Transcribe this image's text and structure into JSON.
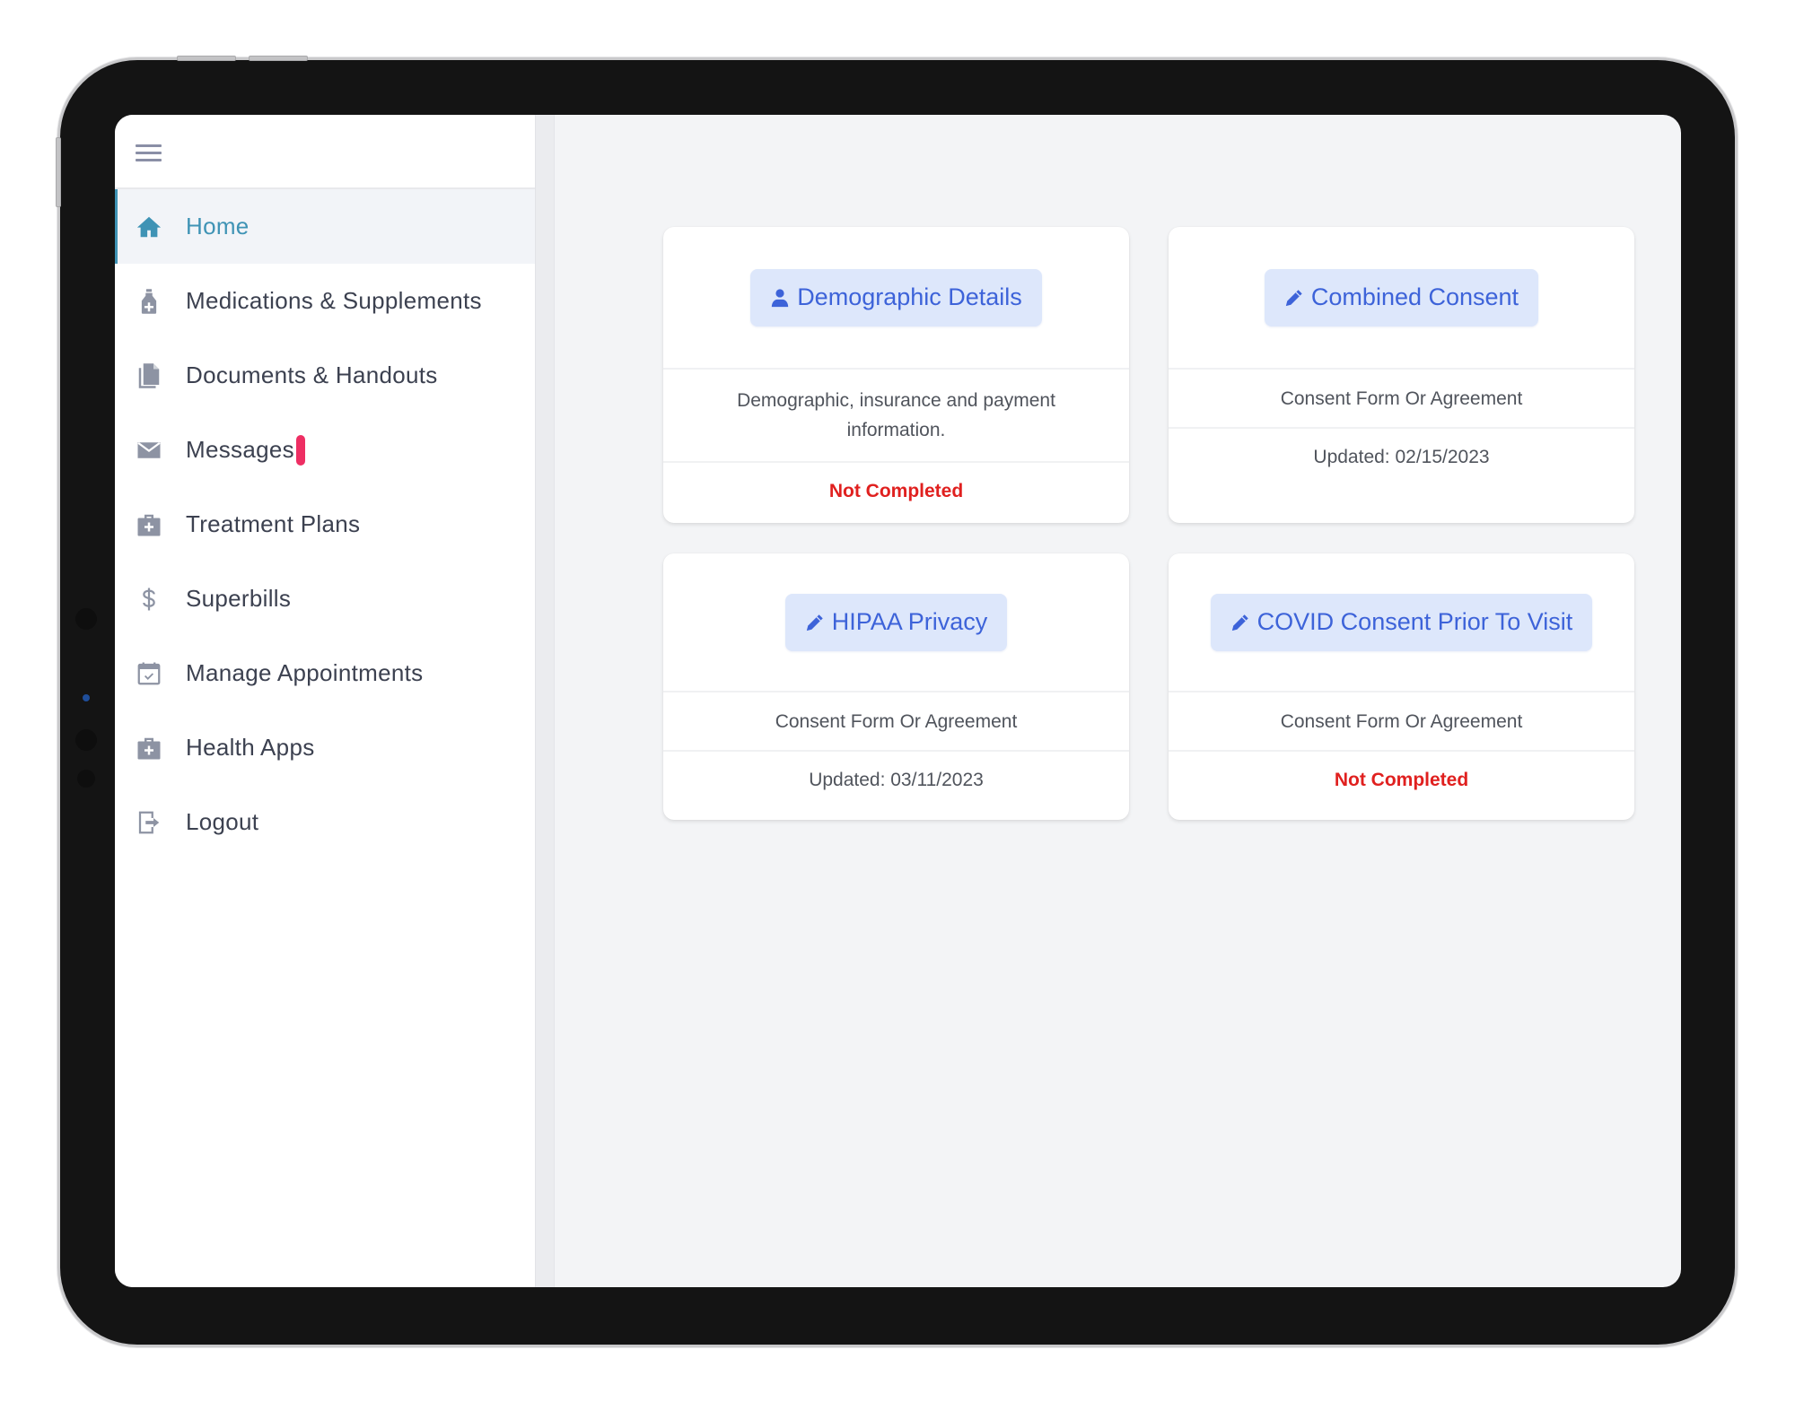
{
  "device": {
    "frame": "tablet"
  },
  "sidebar": {
    "menu_icon": "hamburger-icon",
    "items": [
      {
        "label": "Home",
        "icon": "home-icon",
        "active": true
      },
      {
        "label": "Medications & Supplements",
        "icon": "medicine-bottle-icon",
        "active": false
      },
      {
        "label": "Documents & Handouts",
        "icon": "documents-icon",
        "active": false
      },
      {
        "label": "Messages",
        "icon": "envelope-icon",
        "active": false,
        "badge": true
      },
      {
        "label": "Treatment Plans",
        "icon": "medical-kit-icon",
        "active": false
      },
      {
        "label": "Superbills",
        "icon": "dollar-icon",
        "active": false
      },
      {
        "label": "Manage Appointments",
        "icon": "calendar-check-icon",
        "active": false
      },
      {
        "label": "Health Apps",
        "icon": "medical-kit-icon",
        "active": false
      },
      {
        "label": "Logout",
        "icon": "logout-icon",
        "active": false
      }
    ]
  },
  "cards": [
    {
      "button_label": "Demographic Details",
      "icon": "user-icon",
      "description": "Demographic, insurance and payment information.",
      "status": "Not Completed",
      "status_type": "incomplete"
    },
    {
      "button_label": "Combined Consent",
      "icon": "pencil-icon",
      "description": "Consent Form Or Agreement",
      "status": "Updated: 02/15/2023",
      "status_type": "updated"
    },
    {
      "button_label": "HIPAA Privacy",
      "icon": "pencil-icon",
      "description": "Consent Form Or Agreement",
      "status": "Updated: 03/11/2023",
      "status_type": "updated"
    },
    {
      "button_label": "COVID Consent Prior To Visit",
      "icon": "pencil-icon",
      "description": "Consent Form Or Agreement",
      "status": "Not Completed",
      "status_type": "incomplete"
    }
  ],
  "colors": {
    "accent": "#3f93b5",
    "button_bg": "#dde7fb",
    "button_text": "#3d63d9",
    "incomplete": "#e0201f",
    "badge": "#ee2e63"
  }
}
